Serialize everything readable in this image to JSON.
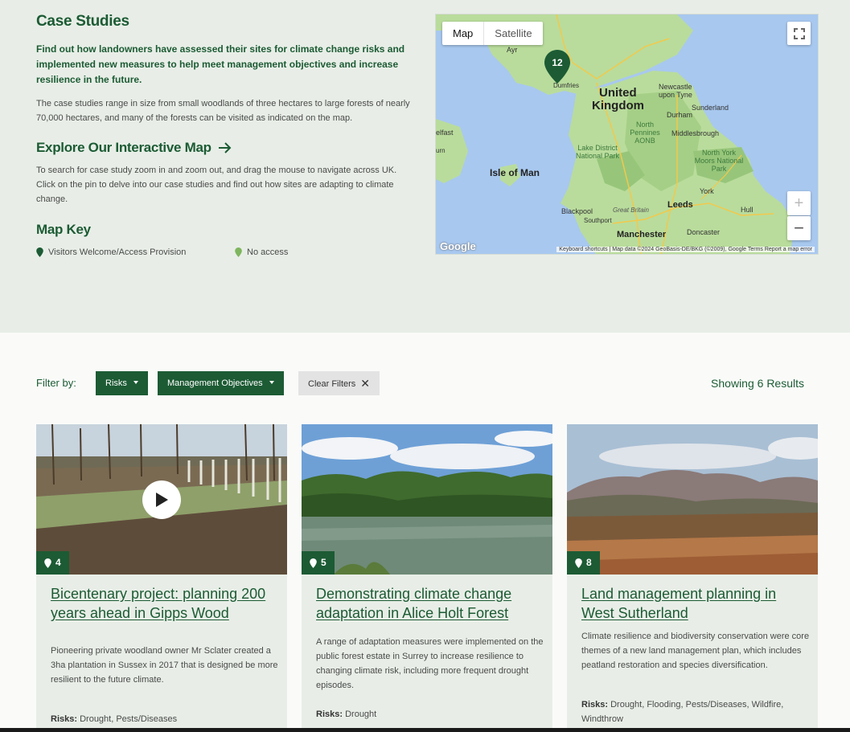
{
  "intro": {
    "title": "Case Studies",
    "lead": "Find out how landowners have assessed their sites for climate change risks and implemented new measures to help meet management objectives and increase resilience in the future.",
    "body": "The case studies range in size from small woodlands of three hectares to large forests of nearly 70,000 hectares, and many of the forests can be visited as indicated on the map.",
    "map_heading": "Explore Our Interactive Map",
    "map_help": "To search for case study zoom in and zoom out, and drag the mouse to navigate across UK. Click on the pin to delve into our case studies and find out how sites are adapting to climate change.",
    "key_heading": "Map Key",
    "key_items": [
      {
        "label": "Visitors Welcome/Access Provision",
        "color": "#1c5b34"
      },
      {
        "label": "No access",
        "color": "#7fb55e"
      }
    ]
  },
  "map": {
    "tabs": [
      "Map",
      "Satellite"
    ],
    "active_tab": "Map",
    "cluster_count": "12",
    "labels": {
      "united": "United",
      "kingdom": "Kingdom",
      "isle_of_man": "Isle of Man",
      "newcastle": "Newcastle",
      "upon_tyne": "upon Tyne",
      "sunderland": "Sunderland",
      "durham": "Durham",
      "middlesbrough": "Middlesbrough",
      "north_pennines": "North Pennines AONB",
      "lake_district": "Lake District National Park",
      "north_york_moors": "North York Moors National Park",
      "york": "York",
      "leeds": "Leeds",
      "hull": "Hull",
      "blackpool": "Blackpool",
      "southport": "Southport",
      "great_britain": "Great Britain",
      "manchester": "Manchester",
      "doncaster": "Doncaster",
      "dumfries": "Dumfries",
      "ayr": "Ayr",
      "belfast": "elfast",
      "burn": "urn"
    },
    "attribution": "Keyboard shortcuts | Map data ©2024 GeoBasis-DE/BKG (©2009), Google   Terms   Report a map error",
    "logo": "Google"
  },
  "filters": {
    "label": "Filter by:",
    "risks": "Risks",
    "objectives": "Management Objectives",
    "clear": "Clear Filters",
    "results": "Showing 6 Results"
  },
  "cards": [
    {
      "count": "4",
      "title": "Bicentenary project: planning 200 years ahead in Gipps Wood",
      "desc": "Pioneering private woodland owner Mr Sclater created a 3ha plantation in Sussex in 2017 that is designed be more resilient to the future climate.",
      "risks_label": "Risks:",
      "risks": "Drought, Pests/Diseases"
    },
    {
      "count": "5",
      "title": "Demonstrating climate change adaptation in Alice Holt Forest",
      "desc": "A range of adaptation measures were implemented on the public forest estate in Surrey to increase resilience to changing climate risk, including more frequent drought episodes.",
      "risks_label": "Risks:",
      "risks": "Drought"
    },
    {
      "count": "8",
      "title": "Land management planning in West Sutherland",
      "desc": "Climate resilience and biodiversity conservation were core themes of a new land management plan, which includes peatland restoration and species diversification.",
      "risks_label": "Risks:",
      "risks": "Drought, Flooding, Pests/Diseases, Wildfire, Windthrow"
    }
  ]
}
